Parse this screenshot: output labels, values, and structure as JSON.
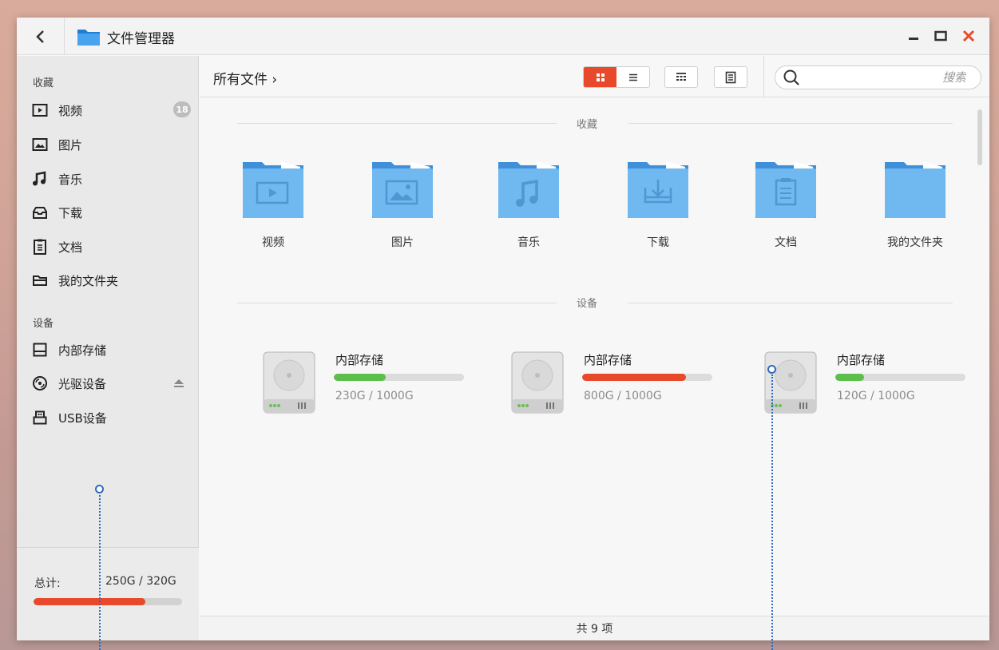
{
  "window": {
    "title": "文件管理器"
  },
  "sidebar": {
    "favorites_title": "收藏",
    "favorites": [
      {
        "label": "视频",
        "icon": "video-icon",
        "badge": "18"
      },
      {
        "label": "图片",
        "icon": "image-icon"
      },
      {
        "label": "音乐",
        "icon": "music-icon"
      },
      {
        "label": "下载",
        "icon": "download-icon"
      },
      {
        "label": "文档",
        "icon": "document-icon"
      },
      {
        "label": "我的文件夹",
        "icon": "folder-icon"
      }
    ],
    "devices_title": "设备",
    "devices": [
      {
        "label": "内部存储",
        "icon": "drive-icon"
      },
      {
        "label": "光驱设备",
        "icon": "disc-icon"
      },
      {
        "label": "USB设备",
        "icon": "usb-icon"
      }
    ],
    "footer": {
      "total_label": "总计:",
      "total_value": "250G / 320G",
      "usage": 0.75
    }
  },
  "toolbar": {
    "breadcrumb": "所有文件 ›",
    "search_placeholder": "搜索"
  },
  "main": {
    "favorites_title": "收藏",
    "favorites": [
      {
        "label": "视频",
        "icon": "video-icon"
      },
      {
        "label": "图片",
        "icon": "image-icon"
      },
      {
        "label": "音乐",
        "icon": "music-icon"
      },
      {
        "label": "下载",
        "icon": "download-icon"
      },
      {
        "label": "文档",
        "icon": "document-icon"
      },
      {
        "label": "我的文件夹",
        "icon": "folder-icon"
      }
    ],
    "devices_title": "设备",
    "devices": [
      {
        "name": "内部存储",
        "size": "230G / 1000G",
        "usage": 0.4,
        "color": "#5cbf4a"
      },
      {
        "name": "内部存储",
        "size": "800G / 1000G",
        "usage": 0.8,
        "color": "#e8492a"
      },
      {
        "name": "内部存储",
        "size": "120G / 1000G",
        "usage": 0.22,
        "color": "#5cbf4a"
      }
    ]
  },
  "status": {
    "count": "共 9 项"
  },
  "colors": {
    "accent": "#e8492a",
    "folder": "#6fb8f0",
    "ok": "#5cbf4a"
  }
}
